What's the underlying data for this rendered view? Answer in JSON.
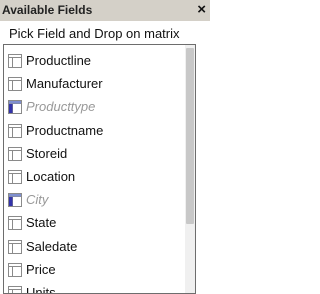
{
  "header": {
    "title": "Available Fields",
    "close_glyph": "×"
  },
  "subtitle": "Pick Field and Drop on matrix",
  "fields": [
    {
      "label": "Productline",
      "in_use": false
    },
    {
      "label": "Manufacturer",
      "in_use": false
    },
    {
      "label": "Producttype",
      "in_use": true
    },
    {
      "label": "Productname",
      "in_use": false
    },
    {
      "label": "Storeid",
      "in_use": false
    },
    {
      "label": "Location",
      "in_use": false
    },
    {
      "label": "City",
      "in_use": true
    },
    {
      "label": "State",
      "in_use": false
    },
    {
      "label": "Saledate",
      "in_use": false
    },
    {
      "label": "Price",
      "in_use": false
    },
    {
      "label": "Units",
      "in_use": false
    }
  ],
  "colors": {
    "icon_border": "#8a8a8a",
    "icon_used_fill": "#3333aa"
  }
}
